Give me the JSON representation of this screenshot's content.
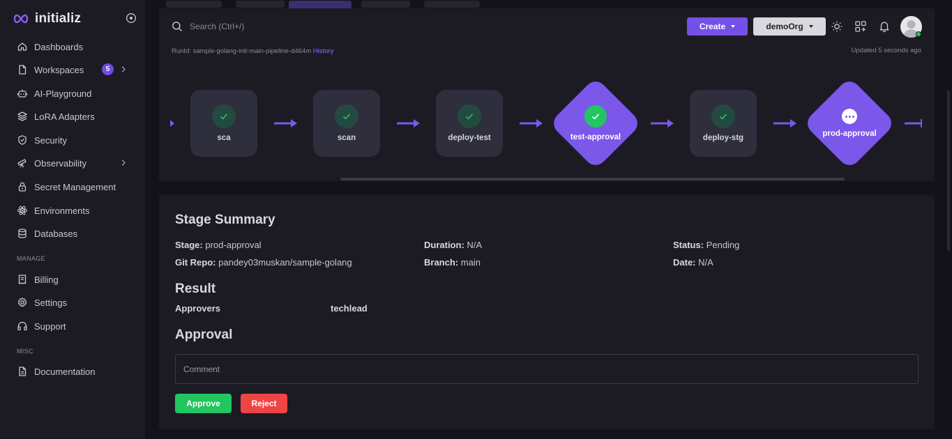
{
  "brand": {
    "name": "initializ"
  },
  "sidebar": {
    "items": [
      {
        "label": "Dashboards",
        "icon": "home-icon"
      },
      {
        "label": "Workspaces",
        "icon": "file-icon",
        "badge": "5"
      },
      {
        "label": "AI-Playground",
        "icon": "robot-icon"
      },
      {
        "label": "LoRA Adapters",
        "icon": "layers-icon"
      },
      {
        "label": "Security",
        "icon": "shield-check-icon"
      },
      {
        "label": "Observability",
        "icon": "telescope-icon"
      },
      {
        "label": "Secret Management",
        "icon": "lock-icon"
      },
      {
        "label": "Environments",
        "icon": "atom-icon"
      },
      {
        "label": "Databases",
        "icon": "database-icon"
      }
    ],
    "manage_label": "MANAGE",
    "manage_items": [
      {
        "label": "Billing",
        "icon": "receipt-icon"
      },
      {
        "label": "Settings",
        "icon": "gear-icon"
      },
      {
        "label": "Support",
        "icon": "headphones-icon"
      }
    ],
    "misc_label": "MISC",
    "misc_items": [
      {
        "label": "Documentation",
        "icon": "document-icon"
      }
    ]
  },
  "header": {
    "search_placeholder": "Search (Ctrl+/)",
    "create_label": "Create",
    "org_label": "demoOrg"
  },
  "run": {
    "runid_text": "RunId: sample-golang-init-main-pipeline-d464m",
    "history_label": "History",
    "updated_text": "Updated 5 seconds ago"
  },
  "pipeline": {
    "stages": [
      {
        "label": "sca",
        "status": "success"
      },
      {
        "label": "scan",
        "status": "success"
      },
      {
        "label": "deploy-test",
        "status": "success"
      },
      {
        "label": "test-approval",
        "status": "success",
        "kind": "approval"
      },
      {
        "label": "deploy-stg",
        "status": "success"
      },
      {
        "label": "prod-approval",
        "status": "pending",
        "kind": "approval"
      }
    ]
  },
  "summary": {
    "title": "Stage Summary",
    "stage_key": "Stage:",
    "stage_val": "prod-approval",
    "duration_key": "Duration:",
    "duration_val": "N/A",
    "status_key": "Status:",
    "status_val": "Pending",
    "repo_key": "Git Repo:",
    "repo_val": "pandey03muskan/sample-golang",
    "branch_key": "Branch:",
    "branch_val": "main",
    "date_key": "Date:",
    "date_val": "N/A",
    "result_title": "Result",
    "approvers_key": "Approvers",
    "approvers_val": "techlead",
    "approval_title": "Approval",
    "comment_placeholder": "Comment",
    "approve_label": "Approve",
    "reject_label": "Reject"
  },
  "colors": {
    "accent": "#7450e8",
    "success": "#22c55e",
    "danger": "#ef4444",
    "background": "#13121a",
    "panel": "#1c1b24"
  }
}
